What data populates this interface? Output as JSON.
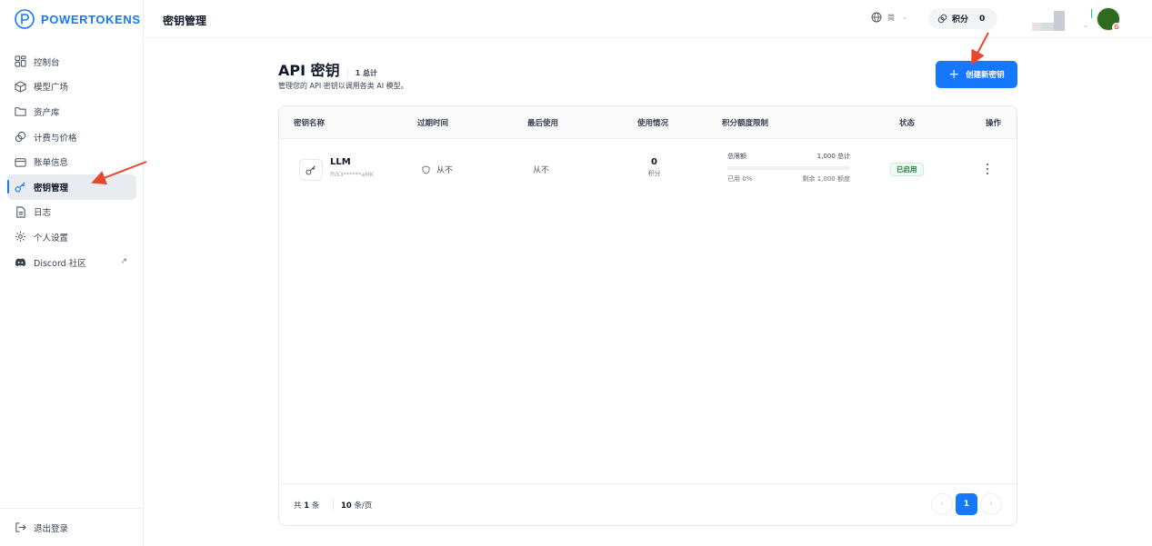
{
  "app": {
    "brand": "POWERTOKENS",
    "brand_color": "#1677ff"
  },
  "sidebar": {
    "items": [
      {
        "label": "控制台",
        "icon": "dashboard-icon"
      },
      {
        "label": "模型广场",
        "icon": "cube-icon"
      },
      {
        "label": "资产库",
        "icon": "folder-icon"
      },
      {
        "label": "计费与价格",
        "icon": "coins-icon"
      },
      {
        "label": "账单信息",
        "icon": "card-icon"
      },
      {
        "label": "密钥管理",
        "icon": "key-icon",
        "active": true
      },
      {
        "label": "日志",
        "icon": "document-icon"
      },
      {
        "label": "个人设置",
        "icon": "gear-icon"
      },
      {
        "label": "Discord 社区",
        "icon": "discord-icon",
        "external": "↗"
      }
    ],
    "logout_label": "退出登录"
  },
  "header": {
    "title": "密钥管理",
    "language_code": "简",
    "points_label": "积分",
    "points_value": "0"
  },
  "main": {
    "title": "API 密钥",
    "count_label": "1 总计",
    "subtitle": "管理您的 API 密钥以调用各类 AI 模型。",
    "create_button_label": "创建新密钥",
    "create_button_icon": "plus-icon"
  },
  "table": {
    "columns": [
      "密钥名称",
      "过期时间",
      "最后使用",
      "使用情况",
      "积分额度限制",
      "状态",
      "操作"
    ],
    "rows": [
      {
        "name": "LLM",
        "masked_key": "fh53******aMK",
        "expire": "从不",
        "last_used": "从不",
        "usage_value": "0",
        "usage_unit": "积分",
        "quota_total_label": "总限额",
        "quota_total_value": "1,000 总计",
        "quota_used_fraction": 0.0,
        "quota_used_label": "已用 0%",
        "quota_remaining_label": "剩余 1,000 额度",
        "status": "已启用"
      }
    ]
  },
  "pagination": {
    "total_prefix": "共",
    "total_count": "1",
    "total_suffix": "条",
    "page_size_value": "10",
    "page_size_suffix": "条/页",
    "prev": "‹",
    "current_page": "1",
    "next": "›"
  }
}
